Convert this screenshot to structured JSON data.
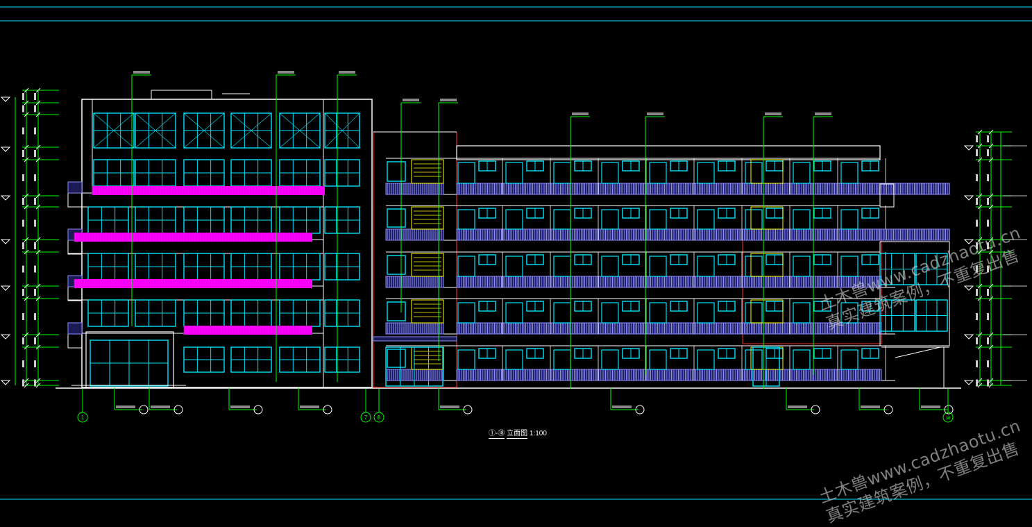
{
  "drawing": {
    "title_prefix": "①-⑱",
    "title_main": "立面图",
    "scale": "1:100"
  },
  "axis_labels": [
    "1",
    "7",
    "8",
    "18"
  ],
  "watermark": {
    "line1": "土木兽www.cadzhaotu.cn",
    "line2": "真实建筑案例，不重复出售"
  },
  "colors": {
    "background": "#000000",
    "window": "#00e5ff",
    "wall": "#ffffff",
    "dimension": "#00ff00",
    "railing": "#8c8cff",
    "band": "#ff00ff",
    "red_outline": "#ff3030",
    "stair": "#ffff00"
  }
}
